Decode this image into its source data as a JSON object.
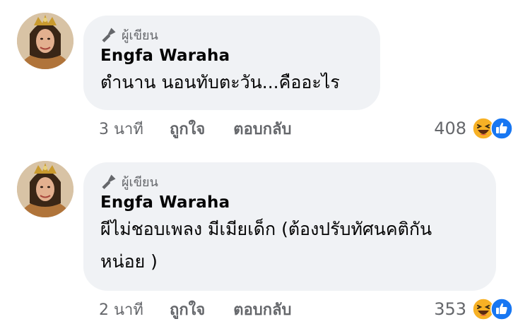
{
  "comments": [
    {
      "badge": "ผู้เขียน",
      "author": "Engfa Waraha",
      "text": "ตำนาน นอนทับตะวัน...คืออะไร",
      "time": "3 นาที",
      "like_label": "ถูกใจ",
      "reply_label": "ตอบกลับ",
      "reaction_count": "408",
      "reactions": [
        "haha-icon",
        "like-icon"
      ]
    },
    {
      "badge": "ผู้เขียน",
      "author": "Engfa Waraha",
      "text_line1": "ผีไม่ชอบเพลง มีเมียเด็ก (ต้องปรับทัศนคติกัน",
      "text_line2": "หน่อย )",
      "time": "2 นาที",
      "like_label": "ถูกใจ",
      "reply_label": "ตอบกลับ",
      "reaction_count": "353",
      "reactions": [
        "haha-icon",
        "like-icon"
      ]
    }
  ],
  "colors": {
    "bubble_bg": "#f0f2f5",
    "meta_text": "#65676b",
    "like_blue": "#1877f2",
    "haha_yellow": "#f7b125"
  }
}
